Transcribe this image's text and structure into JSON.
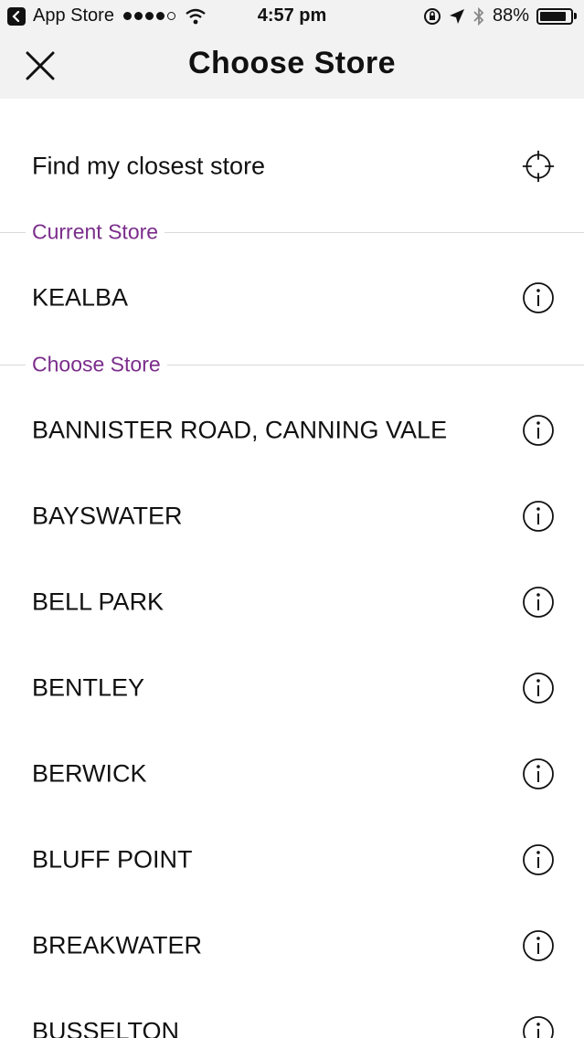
{
  "status_bar": {
    "back_app": "App Store",
    "time": "4:57 pm",
    "battery": "88%",
    "battery_level": 0.88
  },
  "nav": {
    "title": "Choose Store",
    "close_icon": "close-icon"
  },
  "find_closest": {
    "label": "Find my closest store",
    "icon": "crosshair-icon"
  },
  "sections": {
    "current_title": "Current Store",
    "choose_title": "Choose Store"
  },
  "current_store": {
    "name": "KEALBA",
    "icon": "info-icon"
  },
  "stores": [
    "BANNISTER ROAD, CANNING VALE",
    "BAYSWATER",
    "BELL PARK",
    "BENTLEY",
    "BERWICK",
    "BLUFF POINT",
    "BREAKWATER",
    "BUSSELTON"
  ],
  "colors": {
    "accent": "#7b2d8b",
    "bar_background": "#f2f2f3"
  }
}
